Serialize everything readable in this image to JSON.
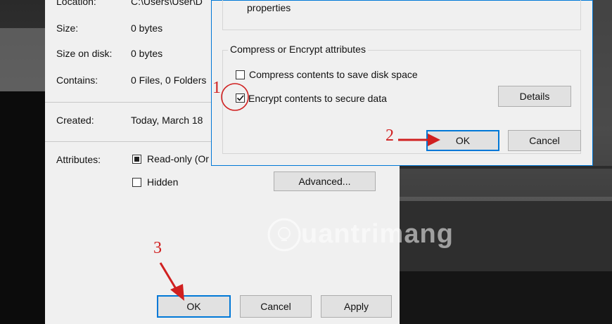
{
  "properties": {
    "location_label": "Location:",
    "location_value": "C:\\Users\\User\\D",
    "size_label": "Size:",
    "size_value": "0 bytes",
    "size_on_disk_label": "Size on disk:",
    "size_on_disk_value": "0 bytes",
    "contains_label": "Contains:",
    "contains_value": "0 Files, 0 Folders",
    "created_label": "Created:",
    "created_value": "Today, March 18",
    "attributes_label": "Attributes:",
    "readonly_label": "Read-only (Or",
    "hidden_label": "Hidden",
    "advanced_button": "Advanced...",
    "ok_button": "OK",
    "cancel_button": "Cancel",
    "apply_button": "Apply"
  },
  "advanced_dialog": {
    "properties_text": "properties",
    "compress_group_title": "Compress or Encrypt attributes",
    "compress_label": "Compress contents to save disk space",
    "encrypt_label": "Encrypt contents to secure data",
    "details_button": "Details",
    "ok_button": "OK",
    "cancel_button": "Cancel",
    "compress_checked": false,
    "encrypt_checked": true
  },
  "annotations": {
    "step1": "1",
    "step2": "2",
    "step3": "3",
    "color": "#d02020"
  },
  "watermark": {
    "text": "uantrimang"
  }
}
